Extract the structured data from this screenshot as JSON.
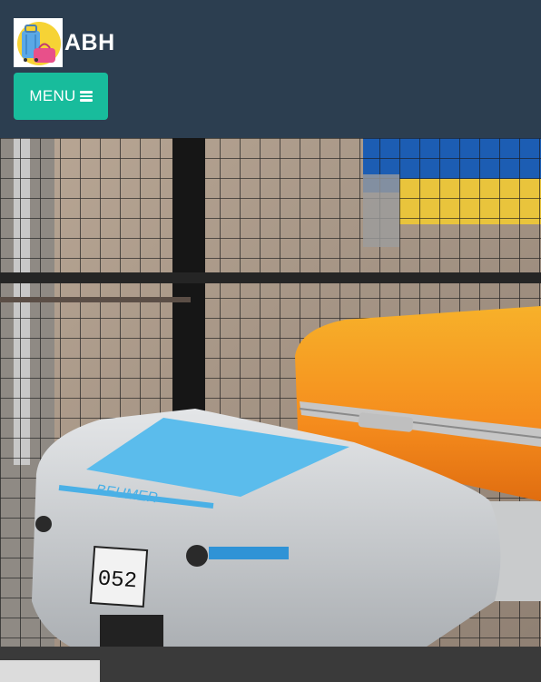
{
  "brand": {
    "name": "ABH",
    "logo_icon": "luggage-icon"
  },
  "nav": {
    "menu_label": "MENU",
    "menu_icon": "bars-icon"
  },
  "hero": {
    "image_subject": "robot-vehicle-with-suitcase",
    "vehicle_brand_text": "BEUMER",
    "vehicle_number": "052"
  },
  "colors": {
    "navbar_bg": "#2c3e50",
    "menu_button_bg": "#18bc9c",
    "text": "#ffffff"
  }
}
